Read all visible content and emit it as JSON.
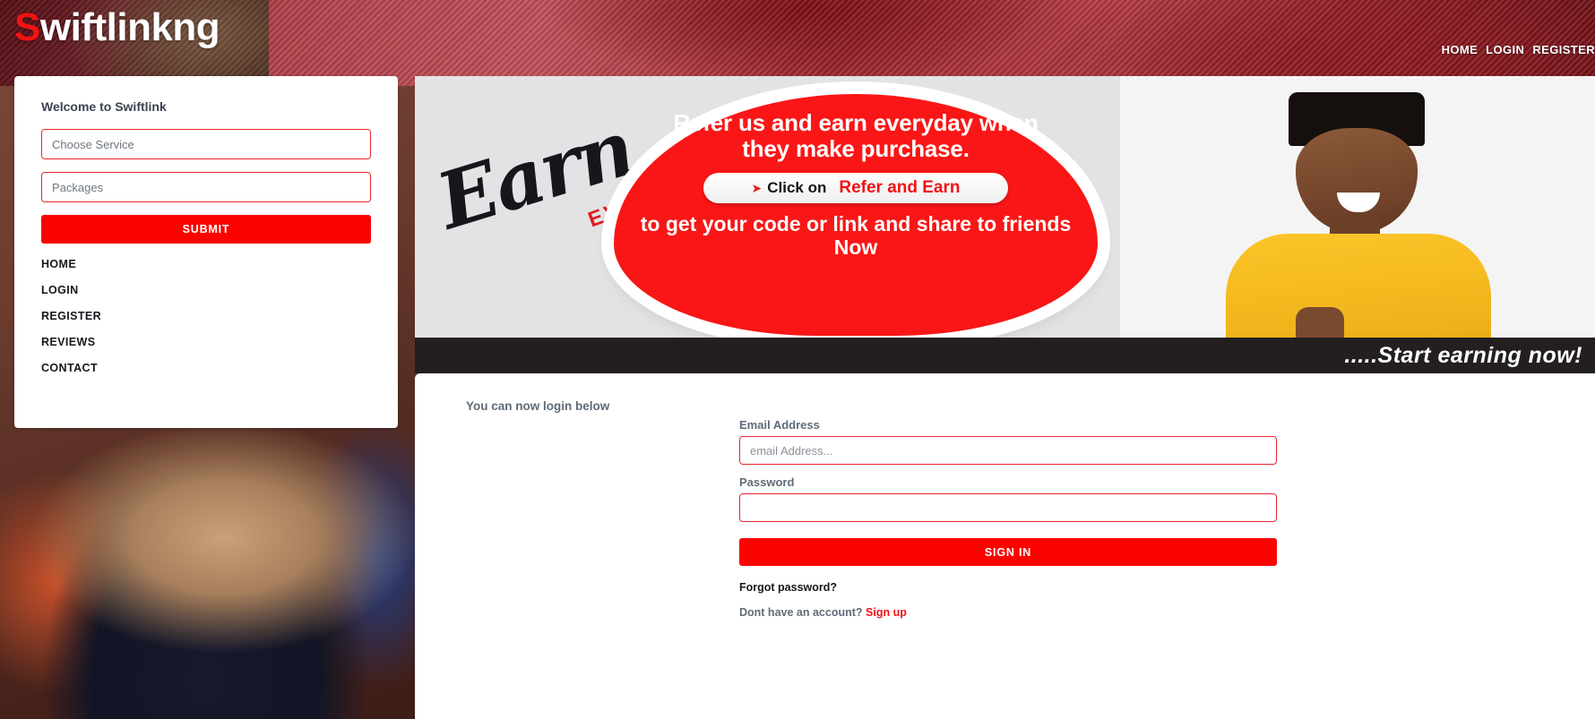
{
  "header": {
    "logo_first_letter": "S",
    "logo_rest": "wiftlinkng",
    "nav": [
      {
        "label": "HOME"
      },
      {
        "label": "LOGIN"
      },
      {
        "label": "REGISTER"
      }
    ]
  },
  "side_card": {
    "welcome_title": "Welcome to Swiftlink",
    "service_placeholder": "Choose Service",
    "packages_placeholder": "Packages",
    "submit_label": "SUBMIT",
    "nav_items": [
      {
        "label": "HOME"
      },
      {
        "label": "LOGIN"
      },
      {
        "label": "REGISTER"
      },
      {
        "label": "REVIEWS"
      },
      {
        "label": "CONTACT"
      }
    ]
  },
  "banner": {
    "earn_word": "Earn",
    "everyday_word": "EVERYDAY",
    "headline": "Refer us and earn everyday when they make purchase.",
    "cursor_icon": "cursor-arrow-icon",
    "pill_prefix": "Click on",
    "pill_link": "Refer and Earn",
    "tail": "to get your code or link and share to friends Now",
    "strip_text": ".....Start earning now!"
  },
  "main": {
    "notice": "You can now login below",
    "form": {
      "email_label": "Email Address",
      "email_placeholder": "email Address...",
      "email_value": "",
      "password_label": "Password",
      "password_placeholder": "",
      "password_value": "",
      "signin_label": "SIGN IN",
      "forgot_label": "Forgot password?",
      "signup_prompt": "Dont have an account?",
      "signup_link": "Sign up"
    }
  },
  "colors": {
    "brand_red": "#fb0300",
    "border_red": "#e8262d",
    "link_red": "#f21116",
    "dark_strip": "#231f20",
    "label_grey": "#5f6b78"
  }
}
